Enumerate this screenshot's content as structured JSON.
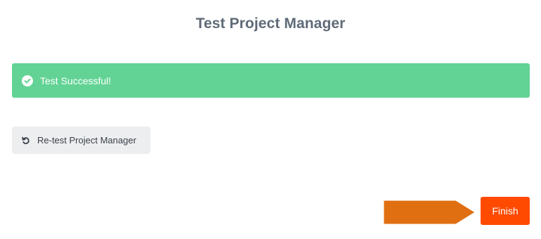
{
  "header": {
    "title": "Test Project Manager"
  },
  "status": {
    "message": "Test Successful!",
    "icon": "check-circle-icon",
    "color": "#62d394"
  },
  "actions": {
    "retest_label": "Re-test Project Manager",
    "retest_icon": "retry-icon",
    "finish_label": "Finish",
    "finish_color": "#ff4a00"
  },
  "annotation": {
    "pointer_icon": "arrow-pointer-icon",
    "pointer_color": "#e06f12"
  }
}
